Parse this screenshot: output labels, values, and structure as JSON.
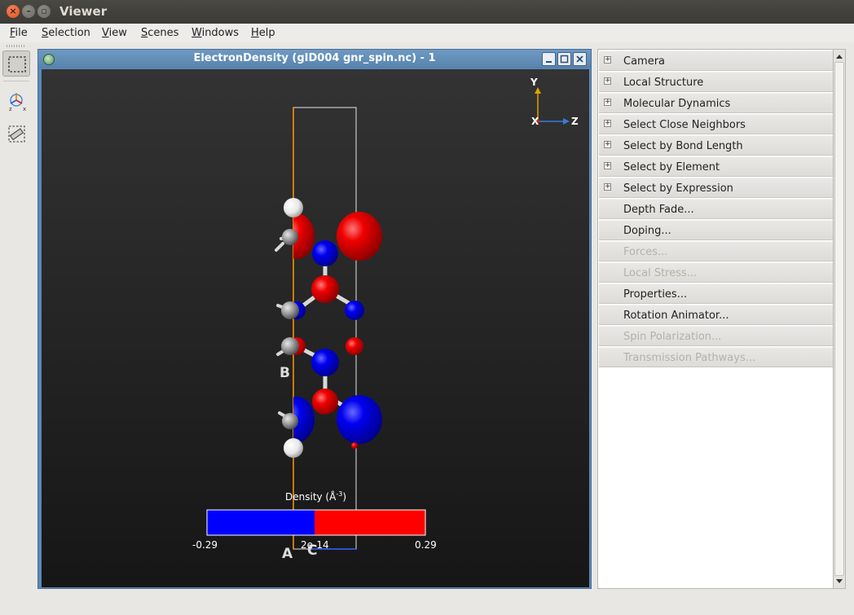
{
  "window": {
    "title": "Viewer"
  },
  "menubar": [
    {
      "first": "F",
      "rest": "ile"
    },
    {
      "first": "S",
      "rest": "election"
    },
    {
      "first": "V",
      "rest": "iew"
    },
    {
      "first": "S",
      "rest": "cenes"
    },
    {
      "first": "W",
      "rest": "indows"
    },
    {
      "first": "H",
      "rest": "elp"
    }
  ],
  "subwindow": {
    "title": "ElectronDensity (gID004 gnr_spin.nc) - 1",
    "axes": {
      "y": "Y",
      "z": "Z",
      "x": "X"
    },
    "cell_labels": {
      "a": "A",
      "b": "B",
      "c": "C"
    },
    "colorbar": {
      "title": "Density (Å",
      "title_exp": "-3",
      "title_end": ")",
      "min_label": "-0.29",
      "mid_label": "2e-14",
      "max_label": "0.29",
      "min_color": "#0000ff",
      "max_color": "#ff0000"
    }
  },
  "panel": {
    "items": [
      {
        "label": "Camera",
        "expandable": true,
        "enabled": true
      },
      {
        "label": "Local Structure",
        "expandable": true,
        "enabled": true
      },
      {
        "label": "Molecular Dynamics",
        "expandable": true,
        "enabled": true
      },
      {
        "label": "Select Close Neighbors",
        "expandable": true,
        "enabled": true
      },
      {
        "label": "Select by Bond Length",
        "expandable": true,
        "enabled": true
      },
      {
        "label": "Select by Element",
        "expandable": true,
        "enabled": true
      },
      {
        "label": "Select by Expression",
        "expandable": true,
        "enabled": true
      },
      {
        "label": "Depth Fade...",
        "expandable": false,
        "enabled": true
      },
      {
        "label": "Doping...",
        "expandable": false,
        "enabled": true
      },
      {
        "label": "Forces...",
        "expandable": false,
        "enabled": false
      },
      {
        "label": "Local Stress...",
        "expandable": false,
        "enabled": false
      },
      {
        "label": "Properties...",
        "expandable": false,
        "enabled": true
      },
      {
        "label": "Rotation Animator...",
        "expandable": false,
        "enabled": true
      },
      {
        "label": "Spin Polarization...",
        "expandable": false,
        "enabled": false
      },
      {
        "label": "Transmission Pathways...",
        "expandable": false,
        "enabled": false
      }
    ],
    "expand_glyph": "+"
  },
  "colors": {
    "titlebar": "#3c3b37",
    "subwindow_title": "#5b86b0",
    "spin_up": "#ff0000",
    "spin_down": "#0000ff",
    "carbon": "#9a9a9a",
    "hydrogen": "#ffffff",
    "cell_edge": "#ffffff",
    "axis_a": "#ff9900"
  }
}
